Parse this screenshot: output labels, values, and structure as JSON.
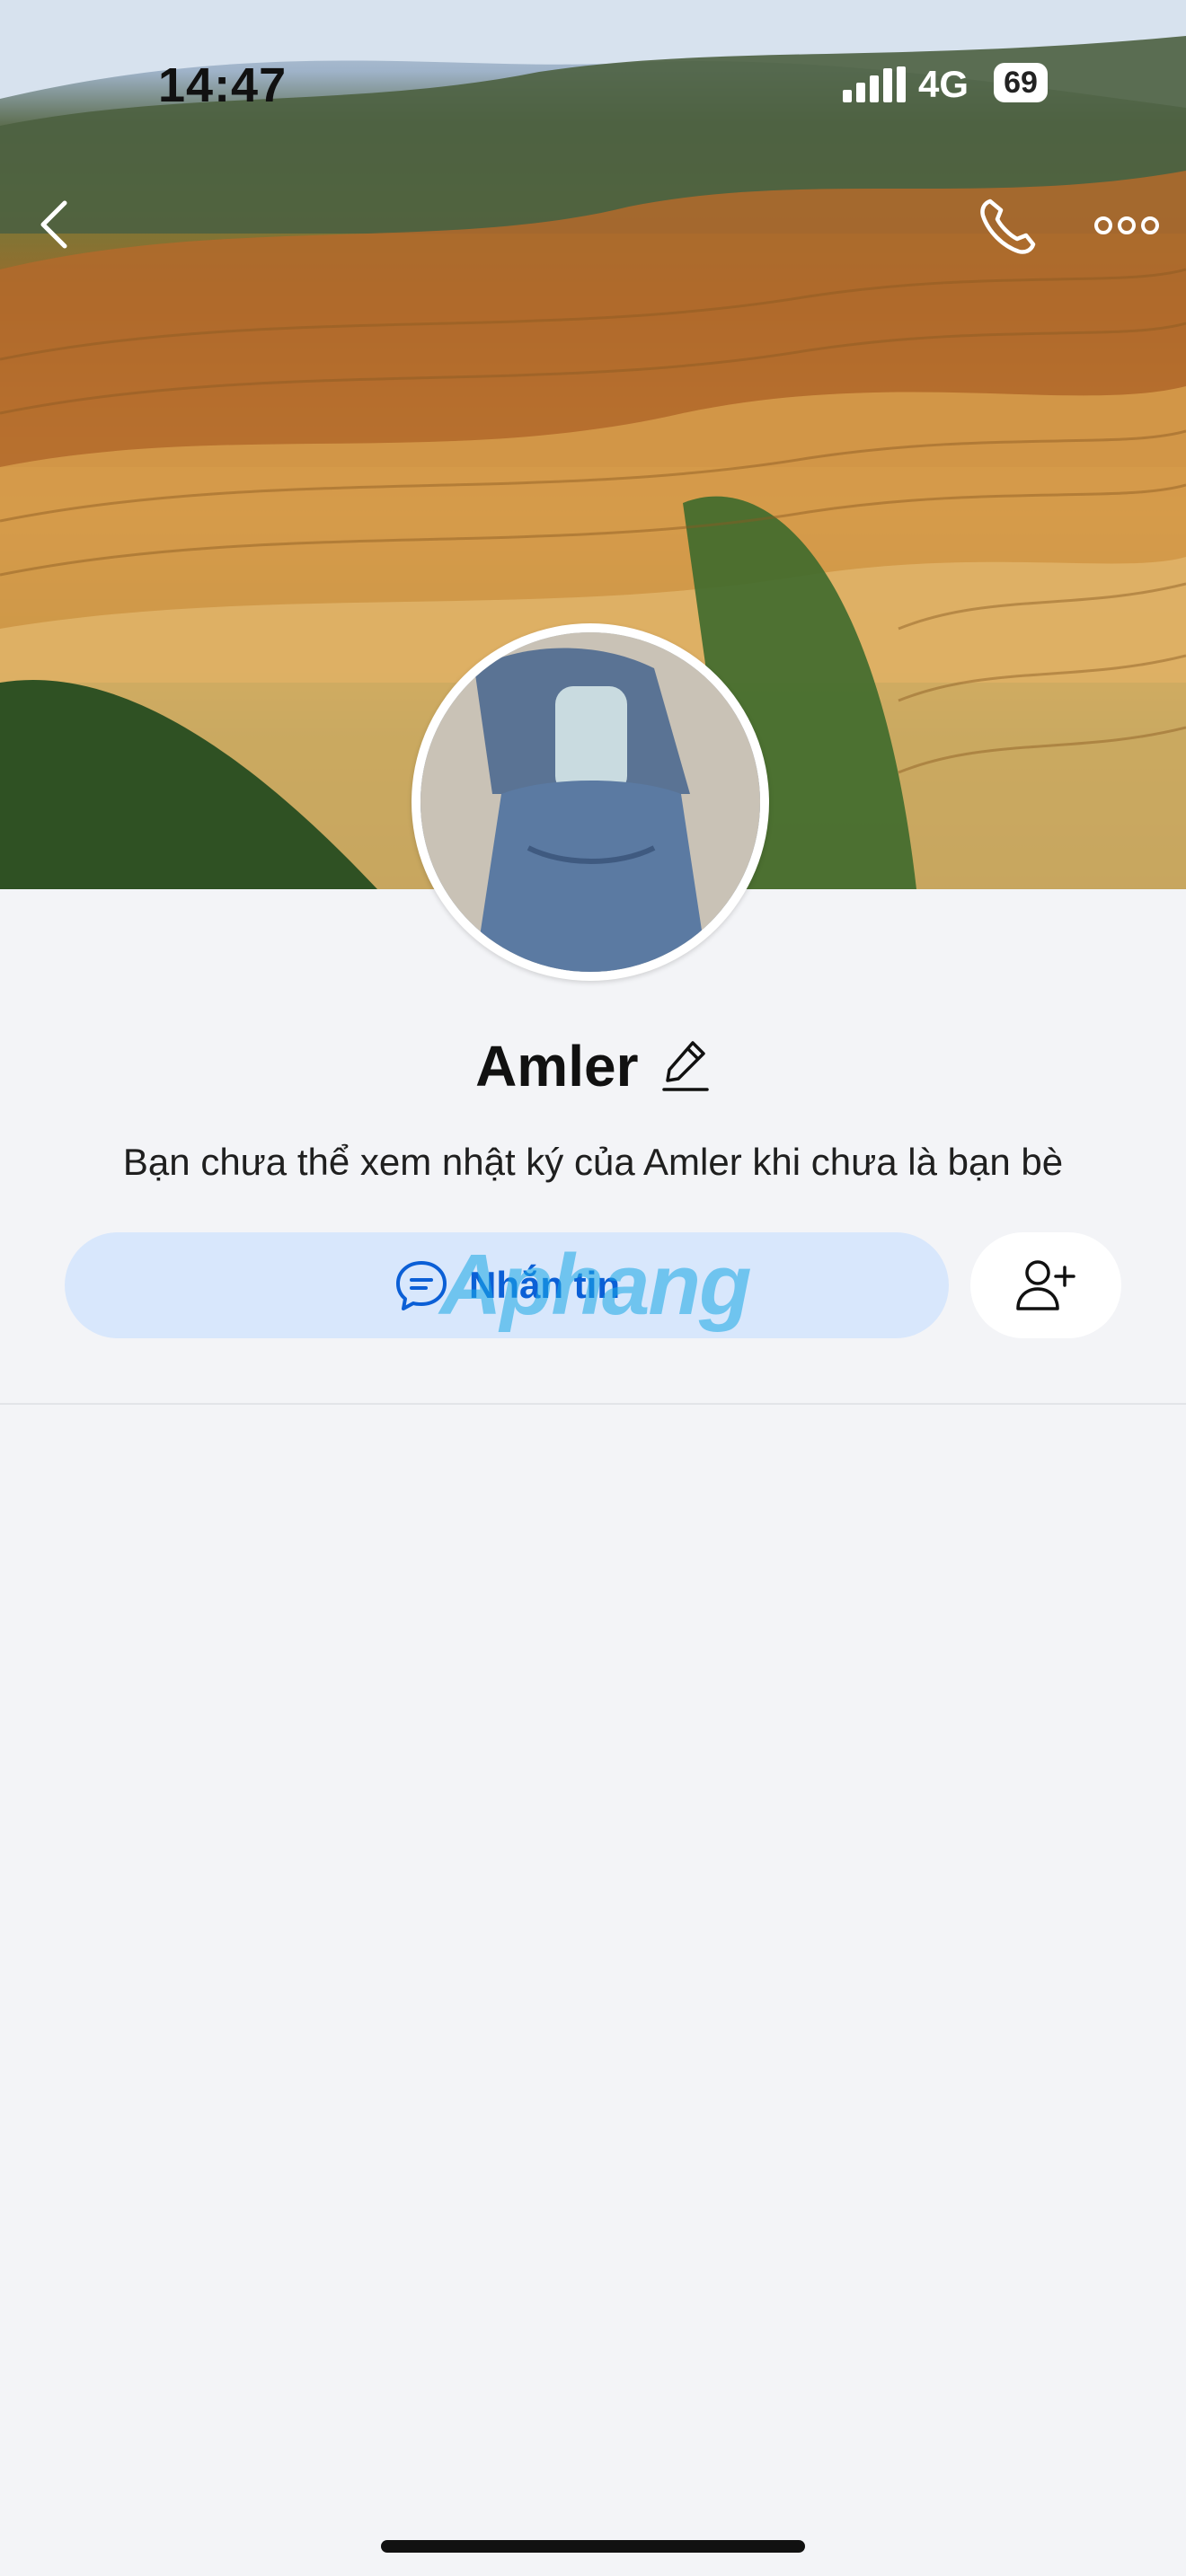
{
  "status_bar": {
    "time": "14:47",
    "network": "4G",
    "battery": "69"
  },
  "icons": {
    "back": "chevron-left-icon",
    "call": "phone-icon",
    "more": "more-horizontal-icon",
    "edit": "pencil-icon",
    "message": "chat-bubble-icon",
    "add_friend": "user-plus-icon"
  },
  "profile": {
    "name": "Amler",
    "notice": "Bạn chưa thể xem nhật ký của Amler khi chưa là bạn bè"
  },
  "actions": {
    "message_label": "Nhắn tin"
  },
  "watermark": "Aphang",
  "colors": {
    "accent": "#0b5fd6",
    "button_bg": "#d8e7fc",
    "page_bg": "#f3f4f7"
  }
}
